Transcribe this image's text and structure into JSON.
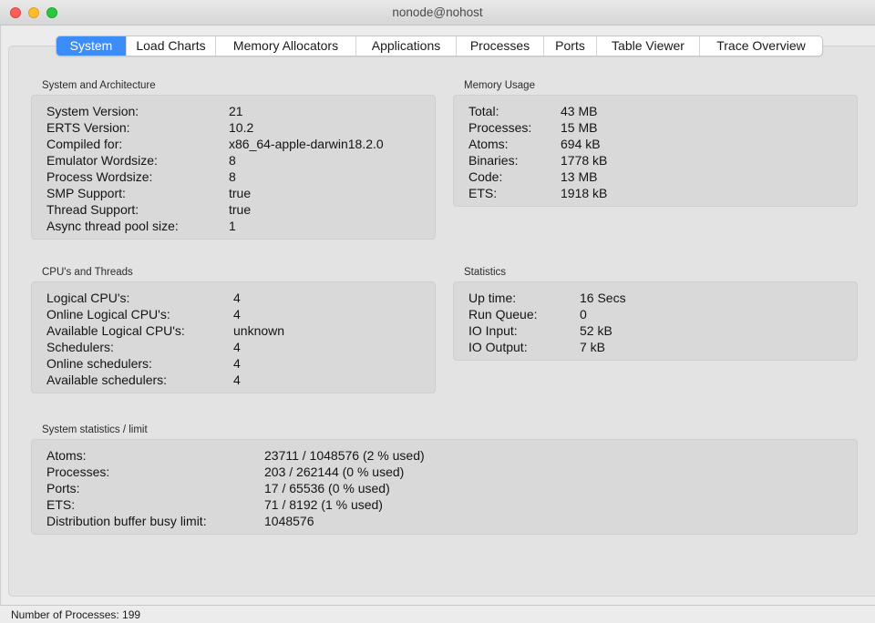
{
  "window": {
    "title": "nonode@nohost"
  },
  "tabs": [
    {
      "label": "System",
      "active": true
    },
    {
      "label": "Load Charts"
    },
    {
      "label": "Memory Allocators"
    },
    {
      "label": "Applications"
    },
    {
      "label": "Processes"
    },
    {
      "label": "Ports"
    },
    {
      "label": "Table Viewer"
    },
    {
      "label": "Trace Overview"
    }
  ],
  "system_arch": {
    "title": "System and Architecture",
    "rows": [
      {
        "label": "System Version:",
        "value": "21"
      },
      {
        "label": "ERTS Version:",
        "value": "10.2"
      },
      {
        "label": "Compiled for:",
        "value": "x86_64-apple-darwin18.2.0"
      },
      {
        "label": "Emulator Wordsize:",
        "value": "8"
      },
      {
        "label": "Process Wordsize:",
        "value": "8"
      },
      {
        "label": "SMP Support:",
        "value": "true"
      },
      {
        "label": "Thread Support:",
        "value": "true"
      },
      {
        "label": "Async thread pool size:",
        "value": "1"
      }
    ]
  },
  "memory_usage": {
    "title": "Memory Usage",
    "rows": [
      {
        "label": "Total:",
        "value": "43 MB"
      },
      {
        "label": "Processes:",
        "value": "15 MB"
      },
      {
        "label": "Atoms:",
        "value": "694 kB"
      },
      {
        "label": "Binaries:",
        "value": "1778 kB"
      },
      {
        "label": "Code:",
        "value": "13 MB"
      },
      {
        "label": "ETS:",
        "value": "1918 kB"
      }
    ]
  },
  "cpu_threads": {
    "title": "CPU's and Threads",
    "rows": [
      {
        "label": "Logical CPU's:",
        "value": "4"
      },
      {
        "label": "Online Logical CPU's:",
        "value": "4"
      },
      {
        "label": "Available Logical CPU's:",
        "value": "unknown"
      },
      {
        "label": "Schedulers:",
        "value": "4"
      },
      {
        "label": "Online schedulers:",
        "value": "4"
      },
      {
        "label": "Available schedulers:",
        "value": "4"
      }
    ]
  },
  "statistics": {
    "title": "Statistics",
    "rows": [
      {
        "label": "Up time:",
        "value": "16 Secs"
      },
      {
        "label": "Run Queue:",
        "value": "0"
      },
      {
        "label": "IO Input:",
        "value": "52 kB"
      },
      {
        "label": "IO Output:",
        "value": "7 kB"
      }
    ]
  },
  "limits": {
    "title": "System statistics / limit",
    "rows": [
      {
        "label": "Atoms:",
        "value": "23711 / 1048576 (2 % used)"
      },
      {
        "label": "Processes:",
        "value": "203 / 262144 (0 % used)"
      },
      {
        "label": "Ports:",
        "value": "17 / 65536 (0 % used)"
      },
      {
        "label": "ETS:",
        "value": "71 / 8192 (1 % used)"
      },
      {
        "label": "Distribution buffer busy limit:",
        "value": "1048576"
      }
    ]
  },
  "status": {
    "text": "Number of Processes: 199"
  },
  "colors": {
    "accent": "#3c8df7",
    "panel": "#d9d9d9",
    "pane": "#e3e3e3"
  }
}
